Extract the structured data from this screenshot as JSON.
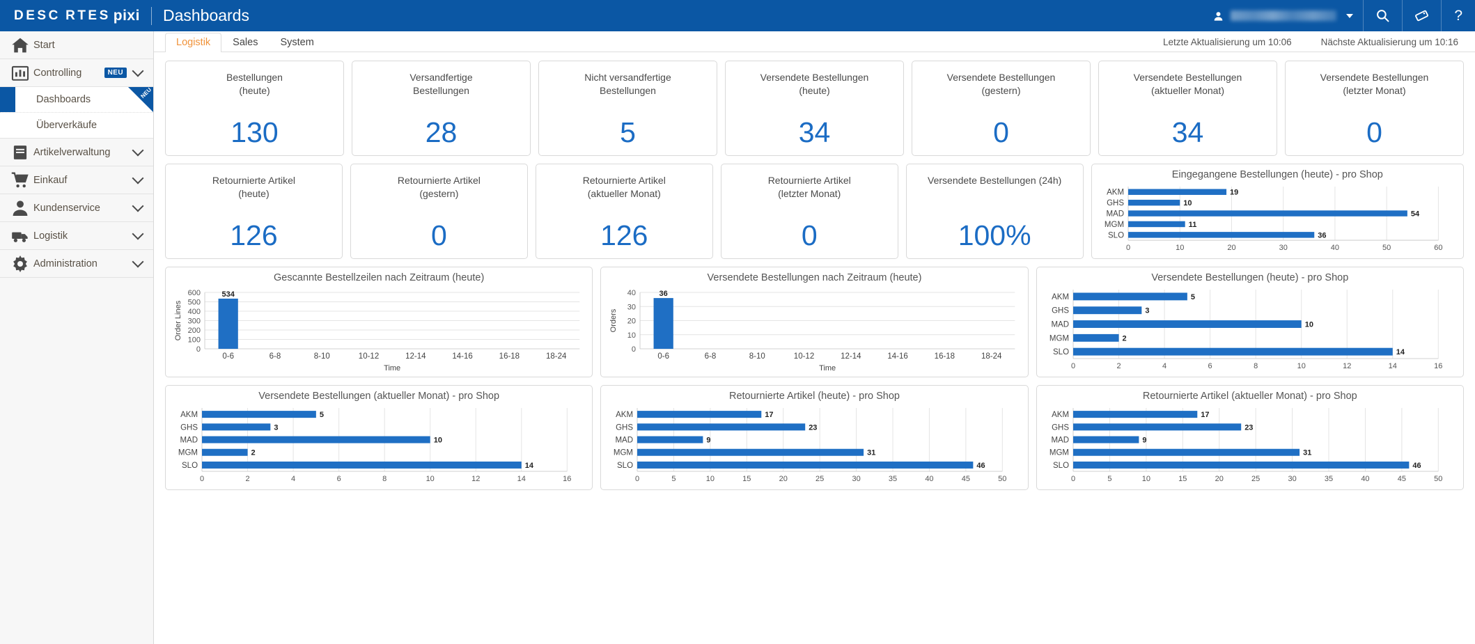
{
  "header": {
    "brand_descartes": "DESC RTES",
    "brand_pixi": "pixi",
    "title": "Dashboards",
    "user_name": "",
    "icons": {
      "user": "user-icon",
      "search": "search-icon",
      "tag": "tag-icon",
      "help": "help-icon"
    }
  },
  "sidebar": {
    "items": [
      {
        "label": "Start",
        "icon": "home-icon",
        "expandable": false,
        "badge": ""
      },
      {
        "label": "Controlling",
        "icon": "chart-icon",
        "expandable": true,
        "badge": "NEU"
      },
      {
        "label": "Artikelverwaltung",
        "icon": "book-icon",
        "expandable": true,
        "badge": ""
      },
      {
        "label": "Einkauf",
        "icon": "cart-icon",
        "expandable": true,
        "badge": ""
      },
      {
        "label": "Kundenservice",
        "icon": "person-icon",
        "expandable": true,
        "badge": ""
      },
      {
        "label": "Logistik",
        "icon": "truck-icon",
        "expandable": true,
        "badge": ""
      },
      {
        "label": "Administration",
        "icon": "gear-icon",
        "expandable": true,
        "badge": ""
      }
    ],
    "sub_items": [
      {
        "label": "Dashboards",
        "active": true,
        "corner_badge": "NEU"
      },
      {
        "label": "Überverkäufe",
        "active": false,
        "corner_badge": ""
      }
    ]
  },
  "tabs": [
    {
      "label": "Logistik",
      "active": true
    },
    {
      "label": "Sales",
      "active": false
    },
    {
      "label": "System",
      "active": false
    }
  ],
  "updates": {
    "last": "Letzte Aktualisierung um 10:06",
    "next": "Nächste Aktualisierung um 10:16"
  },
  "kpis_row1": [
    {
      "title": "Bestellungen\n(heute)",
      "value": "130"
    },
    {
      "title": "Versandfertige\nBestellungen",
      "value": "28"
    },
    {
      "title": "Nicht versandfertige\nBestellungen",
      "value": "5"
    },
    {
      "title": "Versendete Bestellungen\n(heute)",
      "value": "34"
    },
    {
      "title": "Versendete Bestellungen\n(gestern)",
      "value": "0"
    },
    {
      "title": "Versendete Bestellungen\n(aktueller Monat)",
      "value": "34"
    },
    {
      "title": "Versendete Bestellungen\n(letzter Monat)",
      "value": "0"
    }
  ],
  "kpis_row2": [
    {
      "title": "Retournierte Artikel\n(heute)",
      "value": "126"
    },
    {
      "title": "Retournierte Artikel\n(gestern)",
      "value": "0"
    },
    {
      "title": "Retournierte Artikel\n(aktueller Monat)",
      "value": "126"
    },
    {
      "title": "Retournierte Artikel\n(letzter Monat)",
      "value": "0"
    },
    {
      "title": "Versendete Bestellungen (24h)",
      "value": "100%"
    }
  ],
  "colors": {
    "brand_blue": "#0b57a4",
    "bar_blue": "#1f6fc4",
    "kpi_value_blue": "#1b6cc4",
    "tab_active_orange": "#f0933b"
  },
  "chart_data": [
    {
      "id": "eingegangene-bestellungen-heute-pro-shop",
      "type": "bar",
      "orientation": "horizontal",
      "title": "Eingegangene Bestellungen (heute) - pro Shop",
      "categories": [
        "AKM",
        "GHS",
        "MAD",
        "MGM",
        "SLO"
      ],
      "values": [
        19,
        10,
        54,
        11,
        36
      ],
      "xlabel": "",
      "ylabel": "",
      "xlim": [
        0,
        60
      ],
      "xticks": [
        0,
        10,
        20,
        30,
        40,
        50,
        60
      ],
      "grid": true,
      "legend": false,
      "data_labels": true
    },
    {
      "id": "gescannte-bestellzeilen-nach-zeitraum-heute",
      "type": "bar",
      "orientation": "vertical",
      "title": "Gescannte Bestellzeilen nach Zeitraum (heute)",
      "categories": [
        "0-6",
        "6-8",
        "8-10",
        "10-12",
        "12-14",
        "14-16",
        "16-18",
        "18-24"
      ],
      "values": [
        534,
        0,
        0,
        0,
        0,
        0,
        0,
        0
      ],
      "xlabel": "Time",
      "ylabel": "Order Lines",
      "ylim": [
        0,
        600
      ],
      "yticks": [
        0,
        100,
        200,
        300,
        400,
        500,
        600
      ],
      "grid": true,
      "legend": false,
      "data_labels": true
    },
    {
      "id": "versendete-bestellungen-nach-zeitraum-heute",
      "type": "bar",
      "orientation": "vertical",
      "title": "Versendete Bestellungen nach Zeitraum (heute)",
      "categories": [
        "0-6",
        "6-8",
        "8-10",
        "10-12",
        "12-14",
        "14-16",
        "16-18",
        "18-24"
      ],
      "values": [
        36,
        0,
        0,
        0,
        0,
        0,
        0,
        0
      ],
      "xlabel": "Time",
      "ylabel": "Orders",
      "ylim": [
        0,
        40
      ],
      "yticks": [
        0,
        10,
        20,
        30,
        40
      ],
      "grid": true,
      "legend": false,
      "data_labels": true
    },
    {
      "id": "versendete-bestellungen-heute-pro-shop",
      "type": "bar",
      "orientation": "horizontal",
      "title": "Versendete Bestellungen (heute) - pro Shop",
      "categories": [
        "AKM",
        "GHS",
        "MAD",
        "MGM",
        "SLO"
      ],
      "values": [
        5,
        3,
        10,
        2,
        14
      ],
      "xlabel": "",
      "ylabel": "",
      "xlim": [
        0,
        16
      ],
      "xticks": [
        0,
        2,
        4,
        6,
        8,
        10,
        12,
        14,
        16
      ],
      "grid": true,
      "legend": false,
      "data_labels": true
    },
    {
      "id": "versendete-bestellungen-aktueller-monat-pro-shop",
      "type": "bar",
      "orientation": "horizontal",
      "title": "Versendete Bestellungen (aktueller Monat) - pro Shop",
      "categories": [
        "AKM",
        "GHS",
        "MAD",
        "MGM",
        "SLO"
      ],
      "values": [
        5,
        3,
        10,
        2,
        14
      ],
      "xlabel": "",
      "ylabel": "",
      "xlim": [
        0,
        16
      ],
      "xticks": [
        0,
        2,
        4,
        6,
        8,
        10,
        12,
        14,
        16
      ],
      "grid": true,
      "legend": false,
      "data_labels": true
    },
    {
      "id": "retournierte-artikel-heute-pro-shop",
      "type": "bar",
      "orientation": "horizontal",
      "title": "Retournierte Artikel (heute) - pro Shop",
      "categories": [
        "AKM",
        "GHS",
        "MAD",
        "MGM",
        "SLO"
      ],
      "values": [
        17,
        23,
        9,
        31,
        46
      ],
      "xlabel": "",
      "ylabel": "",
      "xlim": [
        0,
        50
      ],
      "xticks": [
        0,
        5,
        10,
        15,
        20,
        25,
        30,
        35,
        40,
        45,
        50
      ],
      "grid": true,
      "legend": false,
      "data_labels": true
    },
    {
      "id": "retournierte-artikel-aktueller-monat-pro-shop",
      "type": "bar",
      "orientation": "horizontal",
      "title": "Retournierte Artikel (aktueller Monat) - pro Shop",
      "categories": [
        "AKM",
        "GHS",
        "MAD",
        "MGM",
        "SLO"
      ],
      "values": [
        17,
        23,
        9,
        31,
        46
      ],
      "xlabel": "",
      "ylabel": "",
      "xlim": [
        0,
        50
      ],
      "xticks": [
        0,
        5,
        10,
        15,
        20,
        25,
        30,
        35,
        40,
        45,
        50
      ],
      "grid": true,
      "legend": false,
      "data_labels": true
    }
  ]
}
